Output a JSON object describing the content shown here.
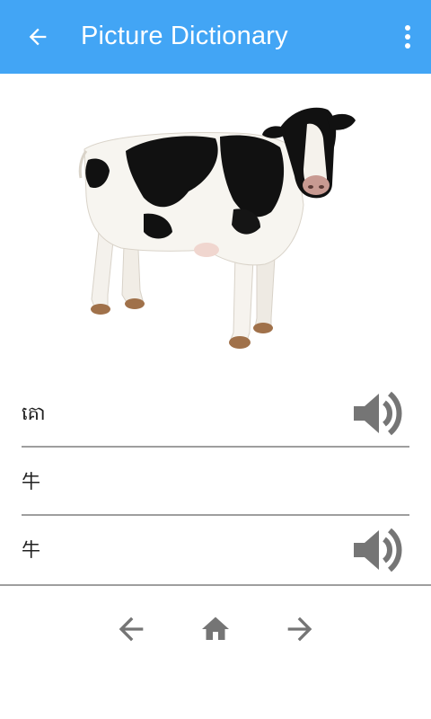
{
  "app_bar": {
    "title": "Picture Dictionary",
    "background": "#42a5f5",
    "back_icon": "arrow-back-icon",
    "menu_icon": "more-vert-icon"
  },
  "entry": {
    "picture": "cow",
    "words": [
      {
        "text": "គោ",
        "has_audio": true
      },
      {
        "text": "牛",
        "has_audio": false
      },
      {
        "text": "牛",
        "has_audio": true
      }
    ]
  },
  "bottom_nav": {
    "previous_icon": "arrow-left-icon",
    "home_icon": "home-icon",
    "next_icon": "arrow-right-icon",
    "icon_color": "#757575"
  }
}
